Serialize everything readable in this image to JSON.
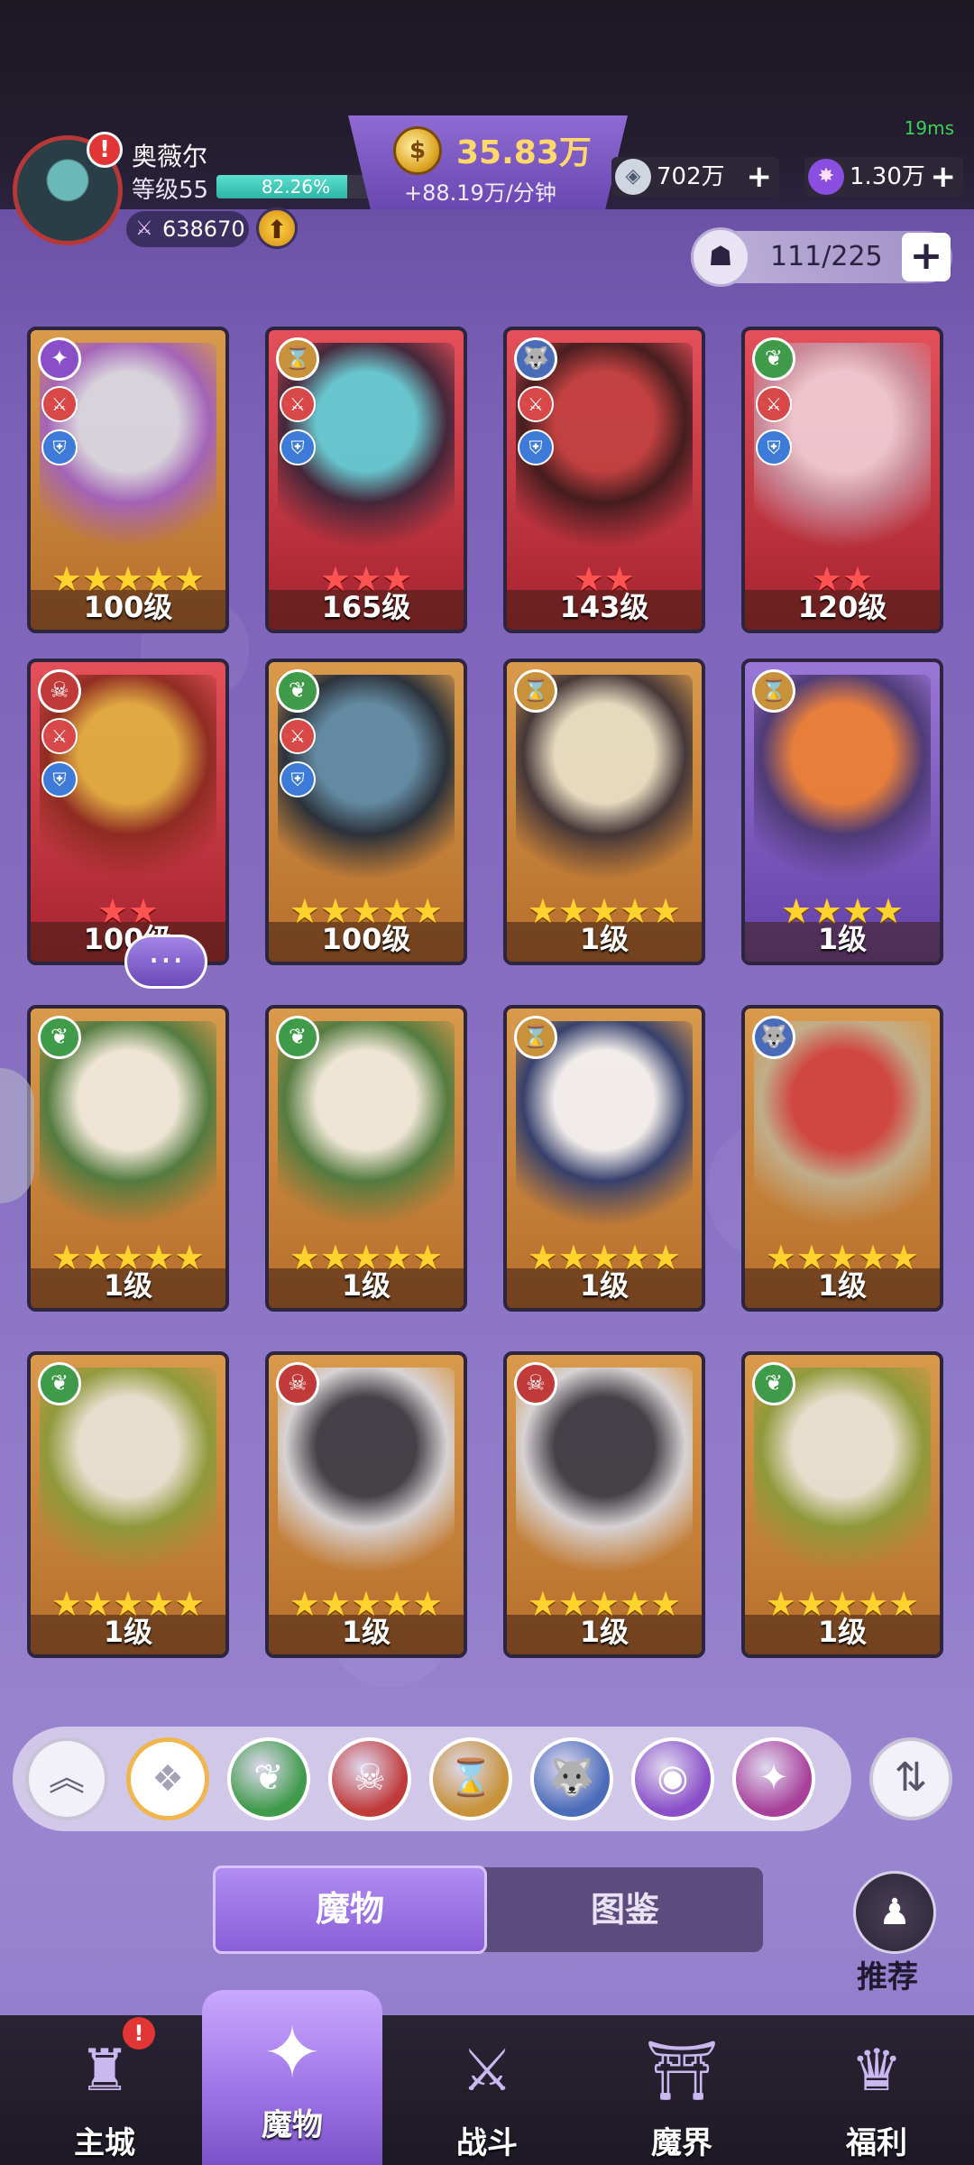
{
  "status": {
    "ping": "19ms"
  },
  "player": {
    "name": "奥薇尔",
    "level_label": "等级55",
    "exp_text": "82.26%",
    "exp_fraction": 0.8226,
    "power": "638670"
  },
  "currency": {
    "gold": "35.83万",
    "gold_rate": "+88.19万/分钟",
    "gems": "702万",
    "crystals": "1.30万"
  },
  "capacity": {
    "text": "111/225"
  },
  "monsters": [
    {
      "faction_icon": "shuriken-faction-icon",
      "faction_glyph": "✦",
      "faction_color": "#8a4fc8",
      "card": "gold",
      "stars": "★★★★★",
      "star_color": "gold",
      "level": "100级",
      "atk": true,
      "def": true,
      "portrait": [
        "#d8d8e8",
        "#a060c0"
      ]
    },
    {
      "faction_icon": "hourglass-faction-icon",
      "faction_glyph": "⌛",
      "faction_color": "#c7923a",
      "card": "red",
      "stars": "★★★",
      "star_color": "red",
      "level": "165级",
      "atk": true,
      "def": true,
      "portrait": [
        "#5fd0d8",
        "#3a2438"
      ]
    },
    {
      "faction_icon": "wolf-faction-icon",
      "faction_glyph": "🐺",
      "faction_color": "#4a6bb8",
      "card": "red",
      "stars": "★★",
      "star_color": "red",
      "level": "143级",
      "atk": true,
      "def": true,
      "portrait": [
        "#c04040",
        "#3a1a1a"
      ]
    },
    {
      "faction_icon": "leaf-faction-icon",
      "faction_glyph": "❦",
      "faction_color": "#3f9a4a",
      "card": "red",
      "stars": "★★",
      "star_color": "red",
      "level": "120级",
      "atk": true,
      "def": true,
      "portrait": [
        "#f0d0d8",
        "#c890a0"
      ]
    },
    {
      "faction_icon": "demon-faction-icon",
      "faction_glyph": "☠",
      "faction_color": "#c03a3a",
      "card": "red",
      "stars": "★★",
      "star_color": "red",
      "level": "100级",
      "atk": true,
      "def": true,
      "portrait": [
        "#e0b040",
        "#8a2a20"
      ]
    },
    {
      "faction_icon": "leaf-faction-icon",
      "faction_glyph": "❦",
      "faction_color": "#3f9a4a",
      "card": "gold",
      "stars": "★★★★★",
      "star_color": "gold",
      "level": "100级",
      "atk": true,
      "def": true,
      "portrait": [
        "#5a8aaa",
        "#1e2a3a"
      ]
    },
    {
      "faction_icon": "hourglass-faction-icon",
      "faction_glyph": "⌛",
      "faction_color": "#c7923a",
      "card": "gold",
      "stars": "★★★★★",
      "star_color": "gold",
      "level": "1级",
      "atk": false,
      "def": false,
      "portrait": [
        "#e8e0c8",
        "#3a3038"
      ]
    },
    {
      "faction_icon": "hourglass-faction-icon",
      "faction_glyph": "⌛",
      "faction_color": "#c7923a",
      "card": "purple",
      "stars": "★★★★",
      "star_color": "gold",
      "level": "1级",
      "atk": false,
      "def": false,
      "portrait": [
        "#f08030",
        "#4a3870"
      ]
    },
    {
      "faction_icon": "leaf-faction-icon",
      "faction_glyph": "❦",
      "faction_color": "#3f9a4a",
      "card": "gold",
      "stars": "★★★★★",
      "star_color": "gold",
      "level": "1级",
      "atk": false,
      "def": false,
      "portrait": [
        "#f0ece0",
        "#4a7a40"
      ]
    },
    {
      "faction_icon": "leaf-faction-icon",
      "faction_glyph": "❦",
      "faction_color": "#3f9a4a",
      "card": "gold",
      "stars": "★★★★★",
      "star_color": "gold",
      "level": "1级",
      "atk": false,
      "def": false,
      "portrait": [
        "#f0ece0",
        "#4a7a40"
      ]
    },
    {
      "faction_icon": "hourglass-faction-icon",
      "faction_glyph": "⌛",
      "faction_color": "#c7923a",
      "card": "gold",
      "stars": "★★★★★",
      "star_color": "gold",
      "level": "1级",
      "atk": false,
      "def": false,
      "portrait": [
        "#f4f4f8",
        "#2a3a70"
      ]
    },
    {
      "faction_icon": "wolf-faction-icon",
      "faction_glyph": "🐺",
      "faction_color": "#4a6bb8",
      "card": "gold",
      "stars": "★★★★★",
      "star_color": "gold",
      "level": "1级",
      "atk": false,
      "def": false,
      "portrait": [
        "#d04040",
        "#c0b090"
      ]
    },
    {
      "faction_icon": "leaf-faction-icon",
      "faction_glyph": "❦",
      "faction_color": "#3f9a4a",
      "card": "gold",
      "stars": "★★★★★",
      "star_color": "gold",
      "level": "1级",
      "atk": false,
      "def": false,
      "portrait": [
        "#e8e4d8",
        "#8a9a3a"
      ]
    },
    {
      "faction_icon": "demon-faction-icon",
      "faction_glyph": "☠",
      "faction_color": "#c03a3a",
      "card": "gold",
      "stars": "★★★★★",
      "star_color": "gold",
      "level": "1级",
      "atk": false,
      "def": false,
      "portrait": [
        "#3a3a48",
        "#d8d8e0"
      ]
    },
    {
      "faction_icon": "demon-faction-icon",
      "faction_glyph": "☠",
      "faction_color": "#c03a3a",
      "card": "gold",
      "stars": "★★★★★",
      "star_color": "gold",
      "level": "1级",
      "atk": false,
      "def": false,
      "portrait": [
        "#3a3a48",
        "#d8d8e0"
      ]
    },
    {
      "faction_icon": "leaf-faction-icon",
      "faction_glyph": "❦",
      "faction_color": "#3f9a4a",
      "card": "gold",
      "stars": "★★★★★",
      "star_color": "gold",
      "level": "1级",
      "atk": false,
      "def": false,
      "portrait": [
        "#e8e4d8",
        "#8a9a3a"
      ]
    }
  ],
  "filters": [
    {
      "name": "collapse-icon",
      "glyph": "︽",
      "style": "plain"
    },
    {
      "name": "all-factions-icon",
      "glyph": "❖",
      "style": "sel"
    },
    {
      "name": "leaf-faction-icon",
      "glyph": "❦",
      "color": "#3f9a4a"
    },
    {
      "name": "demon-faction-icon",
      "glyph": "☠",
      "color": "#c03a3a"
    },
    {
      "name": "hourglass-faction-icon",
      "glyph": "⌛",
      "color": "#c7923a"
    },
    {
      "name": "wolf-faction-icon",
      "glyph": "🐺",
      "color": "#4a6bb8"
    },
    {
      "name": "eye-faction-icon",
      "glyph": "◉",
      "color": "#8a4fc8"
    },
    {
      "name": "shuriken-faction-icon",
      "glyph": "✦",
      "color": "#a8409a"
    }
  ],
  "tabs": {
    "active": "魔物",
    "inactive": "图鉴"
  },
  "recommend": {
    "label": "推荐"
  },
  "nav": [
    {
      "label": "主城",
      "icon": "castle-icon",
      "glyph": "♜",
      "alert": true
    },
    {
      "label": "魔物",
      "icon": "monster-flame-icon",
      "glyph": "✦",
      "active": true
    },
    {
      "label": "战斗",
      "icon": "sword-shield-icon",
      "glyph": "⚔"
    },
    {
      "label": "魔界",
      "icon": "demon-realm-icon",
      "glyph": "⛩"
    },
    {
      "label": "福利",
      "icon": "treasure-chest-icon",
      "glyph": "♛"
    }
  ]
}
